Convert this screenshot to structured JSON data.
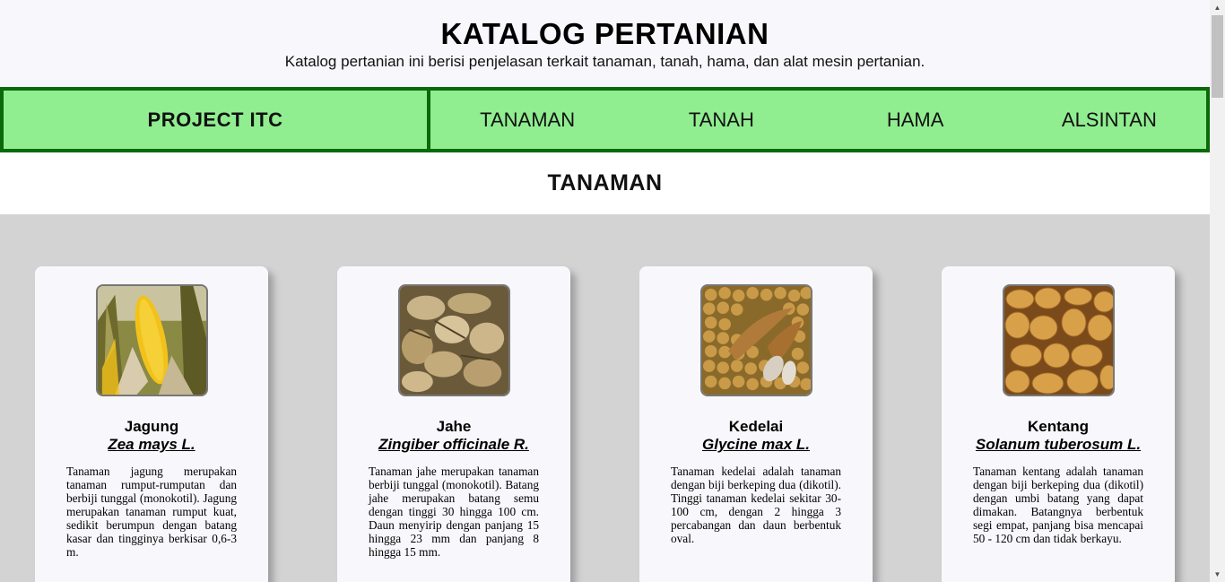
{
  "header": {
    "title": "KATALOG PERTANIAN",
    "subtitle": "Katalog pertanian ini berisi penjelasan terkait tanaman, tanah, hama, dan alat mesin pertanian."
  },
  "nav": {
    "brand": "PROJECT ITC",
    "links": [
      "TANAMAN",
      "TANAH",
      "HAMA",
      "ALSINTAN"
    ]
  },
  "section": {
    "title": "TANAMAN"
  },
  "cards": [
    {
      "name": "Jagung",
      "latin": "Zea mays L.",
      "description": "Tanaman jagung merupakan tanaman rumput-rumputan dan berbiji tunggal (monokotil). Jagung merupakan tanaman rumput kuat, sedikit berumpun dengan batang kasar dan tingginya berkisar 0,6-3 m.",
      "image": "corn-photo"
    },
    {
      "name": "Jahe",
      "latin": "Zingiber officinale R.",
      "description": "Tanaman jahe merupakan tanaman berbiji tunggal (monokotil). Batang jahe merupakan batang semu dengan tinggi 30 hingga 100 cm. Daun menyirip dengan panjang 15 hingga 23 mm dan panjang 8 hingga 15 mm.",
      "image": "ginger-photo"
    },
    {
      "name": "Kedelai",
      "latin": "Glycine max L.",
      "description": "Tanaman kedelai adalah tanaman dengan biji berkeping dua (dikotil). Tinggi tanaman kedelai sekitar 30-100 cm, dengan 2 hingga 3 percabangan dan daun berbentuk oval.",
      "image": "soybean-photo"
    },
    {
      "name": "Kentang",
      "latin": "Solanum tuberosum L.",
      "description": "Tanaman kentang adalah tanaman dengan biji berkeping dua (dikotil) dengan umbi batang yang dapat dimakan. Batangnya berbentuk segi empat, panjang bisa mencapai 50 - 120 cm dan tidak berkayu.",
      "image": "potato-photo"
    }
  ],
  "colors": {
    "nav_bg": "#90ee90",
    "nav_border": "#0a6a0a",
    "catalog_bg": "#d3d3d3",
    "card_bg": "#f8f8fc"
  }
}
